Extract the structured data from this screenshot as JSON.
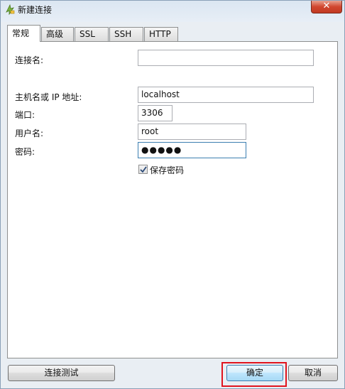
{
  "window": {
    "title": "新建连接",
    "close_glyph": "✕"
  },
  "tabs": [
    {
      "label": "常规",
      "active": true
    },
    {
      "label": "高级",
      "active": false
    },
    {
      "label": "SSL",
      "active": false
    },
    {
      "label": "SSH",
      "active": false
    },
    {
      "label": "HTTP",
      "active": false
    }
  ],
  "form": {
    "connection_name": {
      "label": "连接名:",
      "value": ""
    },
    "host": {
      "label": "主机名或 IP 地址:",
      "value": "localhost"
    },
    "port": {
      "label": "端口:",
      "value": "3306"
    },
    "username": {
      "label": "用户名:",
      "value": "root"
    },
    "password": {
      "label": "密码:",
      "value": "●●●●●"
    },
    "save_password": {
      "label": "保存密码",
      "checked": true
    }
  },
  "buttons": {
    "test_connection": "连接测试",
    "ok": "确定",
    "cancel": "取消"
  },
  "colors": {
    "highlight": "#e0141e",
    "default_button_border": "#3c7fb1"
  }
}
